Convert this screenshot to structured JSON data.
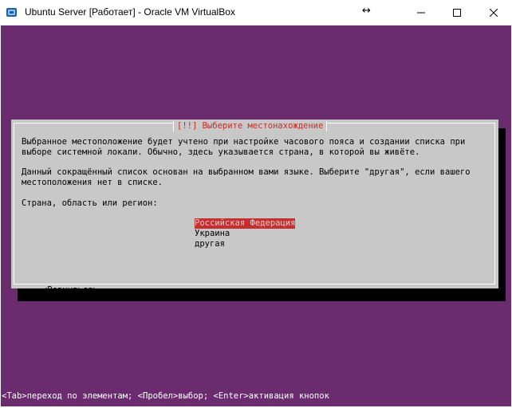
{
  "window": {
    "title": "Ubuntu Server [Работает] - Oracle VM VirtualBox",
    "resize_glyph": "↔"
  },
  "installer": {
    "dialog_title": "[!!] Выберите местонахождение",
    "description_lines": [
      "Выбранное местоположение будет учтено при настройке часового пояса и создании списка при",
      "выборе системной локали. Обычно, здесь указывается страна, в которой вы живёте.",
      "Данный сокращённый список основан на выбранном вами языке. Выберите \"другая\", если вашего",
      "местоположения нет в списке."
    ],
    "prompt": "Страна, область или регион:",
    "options": [
      {
        "label": "Российская Федерация",
        "selected": true
      },
      {
        "label": "Украина",
        "selected": false
      },
      {
        "label": "другая",
        "selected": false
      }
    ],
    "back_button": "<Вернуться>",
    "status_line": "<Tab>переход по элементам; <Пробел>выбор; <Enter>активация кнопок"
  },
  "colors": {
    "screen_bg": "#6a2b6f",
    "dialog_bg": "#c8c8c8",
    "title_red": "#cc2a2a",
    "selection_bg": "#c52f2f"
  },
  "icons": [
    "virtualbox-icon",
    "minimize-icon",
    "maximize-icon",
    "close-icon"
  ]
}
